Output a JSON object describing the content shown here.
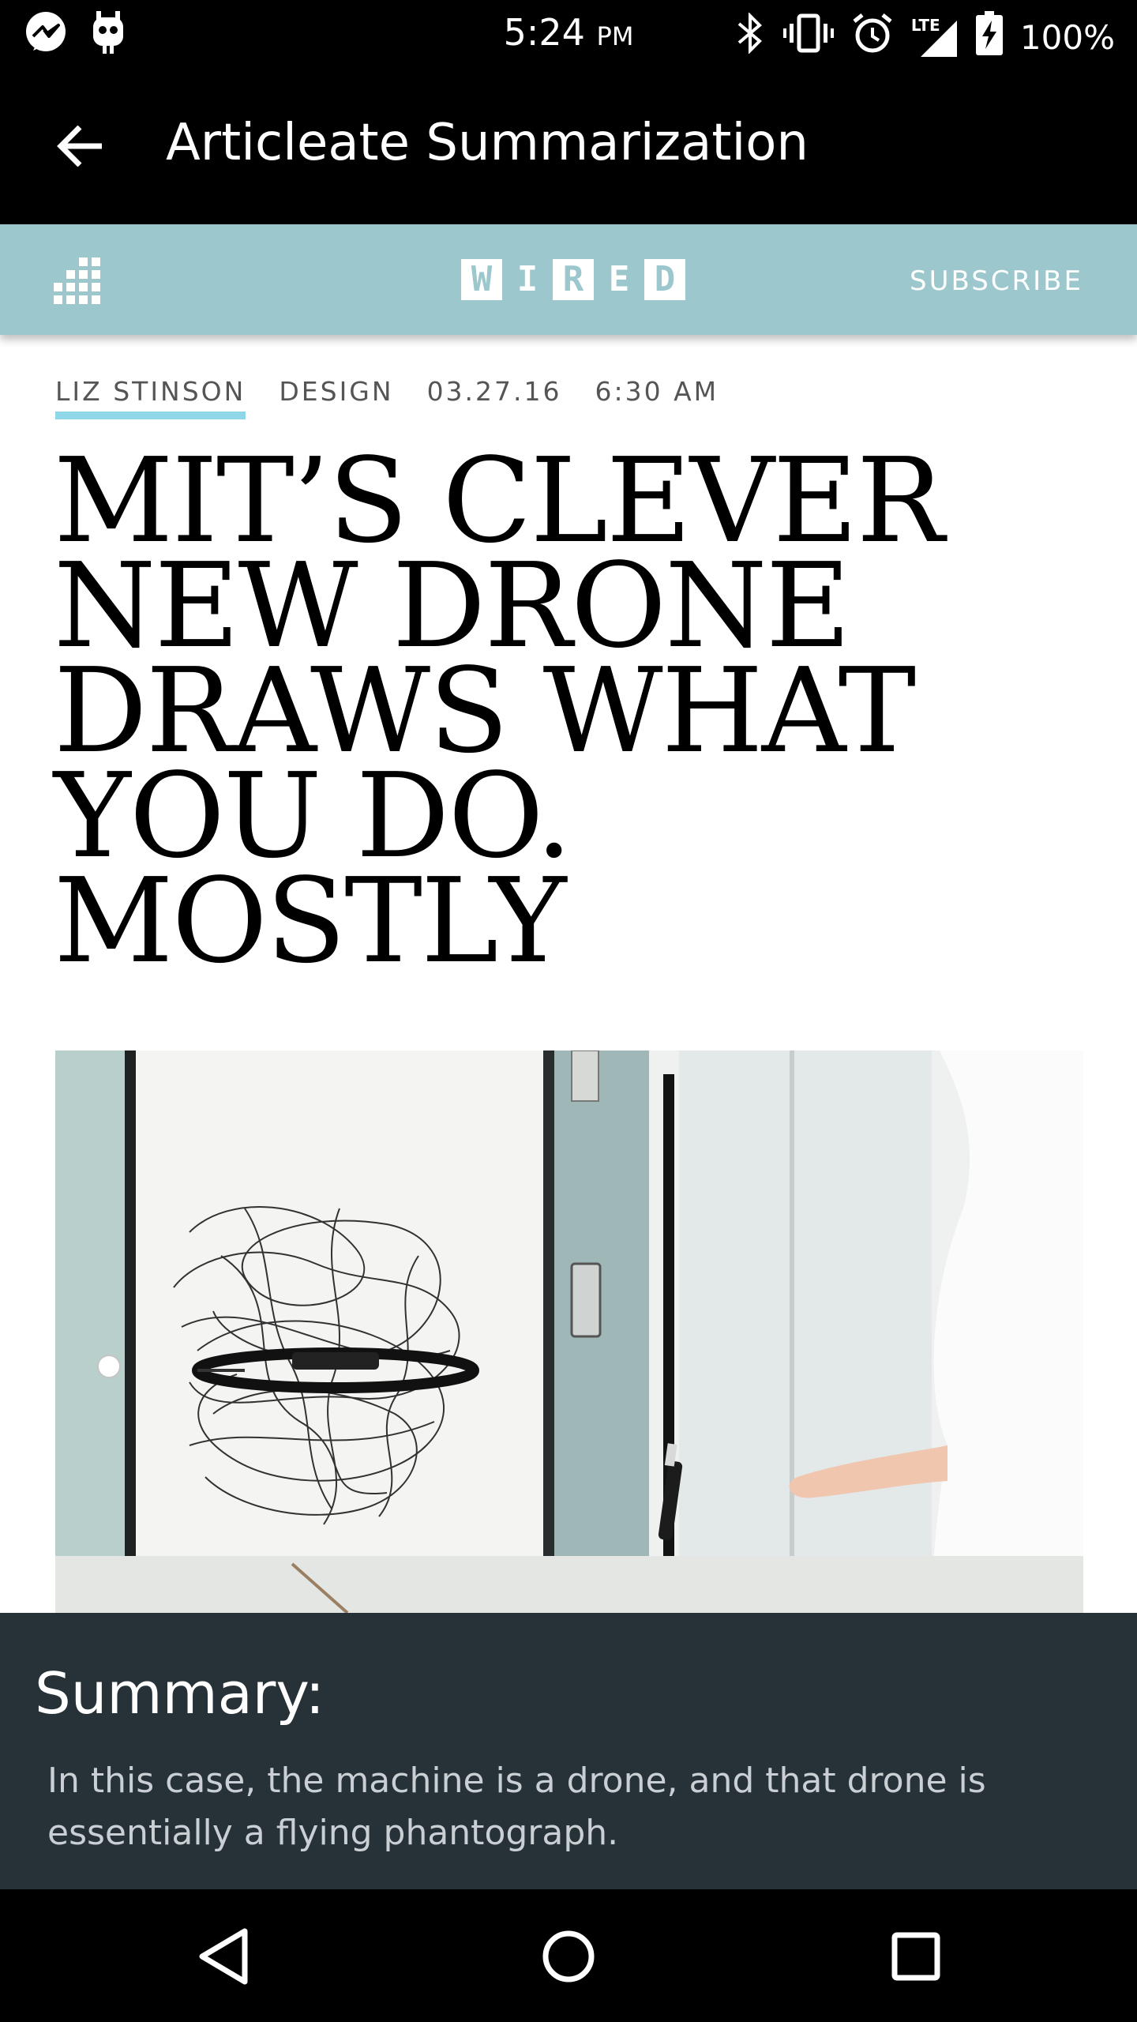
{
  "status_bar": {
    "time": "5:24",
    "ampm": "PM",
    "battery": "100%",
    "network": "LTE",
    "icons": [
      "messenger-icon",
      "cyanogen-icon",
      "bluetooth-icon",
      "vibrate-icon",
      "alarm-icon",
      "signal-icon",
      "battery-charging-icon"
    ]
  },
  "app_bar": {
    "title": "Articleate Summarization",
    "back_icon": "arrow-left-icon"
  },
  "site_header": {
    "logo_letters": [
      "W",
      "I",
      "R",
      "E",
      "D"
    ],
    "subscribe_label": "SUBSCRIBE",
    "menu_icon": "grid-menu-icon",
    "background_color": "#9cc7cd"
  },
  "article": {
    "author": "LIZ STINSON",
    "category": "DESIGN",
    "date": "03.27.16",
    "time": "6:30 AM",
    "headline_lines": [
      "MIT’S CLEVER",
      "NEW DRONE",
      "DRAWS WHAT",
      "YOU DO.",
      "MOSTLY"
    ],
    "image_icon": "drone-drawing-photo"
  },
  "summary": {
    "heading": "Summary:",
    "text": "In this case, the machine is a drone, and that drone is essentially a flying phantograph.",
    "background_color": "#263238"
  },
  "nav_bar": {
    "icons": [
      "back-triangle-icon",
      "home-circle-icon",
      "recents-square-icon"
    ]
  }
}
